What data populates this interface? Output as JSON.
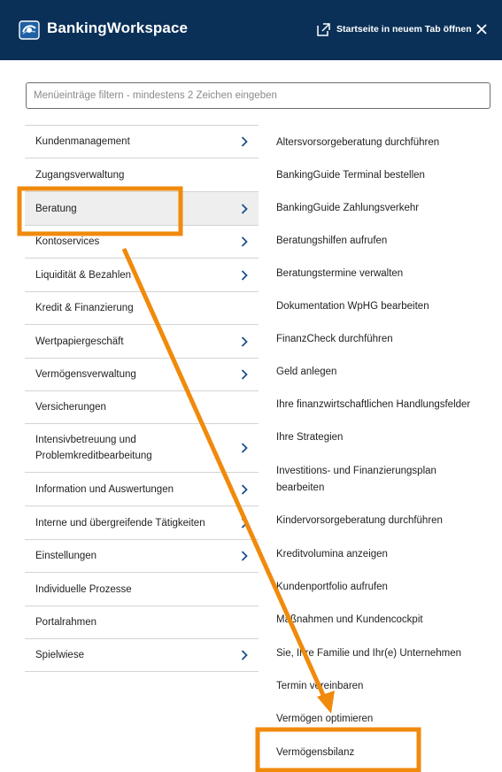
{
  "header": {
    "title": "BankingWorkspace",
    "open_new_tab": "Startseite in neuem Tab öffnen",
    "background": "#0a3058"
  },
  "filter": {
    "placeholder": "Menüeinträge filtern - mindestens 2 Zeichen eingeben",
    "value": ""
  },
  "left_menu": {
    "items": [
      {
        "label": "Kundenmanagement",
        "has_submenu": true
      },
      {
        "label": "Zugangsverwaltung",
        "has_submenu": false
      },
      {
        "label": "Beratung",
        "has_submenu": true,
        "selected": true
      },
      {
        "label": "Kontoservices",
        "has_submenu": true
      },
      {
        "label": "Liquidität & Bezahlen",
        "has_submenu": true
      },
      {
        "label": "Kredit & Finanzierung",
        "has_submenu": false
      },
      {
        "label": "Wertpapiergeschäft",
        "has_submenu": true
      },
      {
        "label": "Vermögensverwaltung",
        "has_submenu": true
      },
      {
        "label": "Versicherungen",
        "has_submenu": false
      },
      {
        "label": "Intensivbetreuung und Problemkreditbearbeitung",
        "has_submenu": true
      },
      {
        "label": "Information und Auswertungen",
        "has_submenu": true
      },
      {
        "label": "Interne und übergreifende Tätigkeiten",
        "has_submenu": true
      },
      {
        "label": "Einstellungen",
        "has_submenu": true
      },
      {
        "label": "Individuelle Prozesse",
        "has_submenu": false
      },
      {
        "label": "Portalrahmen",
        "has_submenu": false
      },
      {
        "label": "Spielwiese",
        "has_submenu": true
      }
    ]
  },
  "sub_menu": {
    "items": [
      "Altersvorsorgeberatung durchführen",
      "BankingGuide Terminal bestellen",
      "BankingGuide Zahlungsverkehr",
      "Beratungshilfen aufrufen",
      "Beratungstermine verwalten",
      "Dokumentation WpHG bearbeiten",
      "FinanzCheck durchführen",
      "Geld anlegen",
      "Ihre finanzwirtschaftlichen Handlungsfelder",
      "Ihre Strategien",
      "Investitions- und Finanzierungsplan bearbeiten",
      "Kindervorsorgeberatung durchführen",
      "Kreditvolumina anzeigen",
      "Kundenportfolio aufrufen",
      "Maßnahmen und Kundencockpit",
      "Sie, Ihre Familie und Ihr(e) Unternehmen",
      "Termin vereinbaren",
      "Vermögen optimieren",
      "Vermögensbilanz"
    ]
  },
  "annotation": {
    "highlight_color": "#f08a0c",
    "icons": [
      "highlight-box-beratung",
      "arrow",
      "highlight-box-vermoegensbilanz"
    ]
  }
}
